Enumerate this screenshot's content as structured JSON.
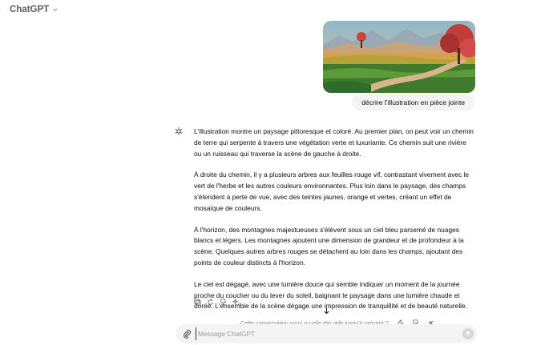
{
  "header": {
    "model_name": "ChatGPT"
  },
  "conversation": {
    "user_message": {
      "text": "décrire l'illustration en pièce jointe"
    },
    "assistant_message": {
      "paragraphs": [
        "L'illustration montre un paysage pittoresque et coloré. Au premier plan, on peut voir un chemin de terre qui serpente à travers une végétation verte et luxuriante. Ce chemin suit une rivière ou un ruisseau qui traverse la scène de gauche à droite.",
        "À droite du chemin, il y a plusieurs arbres aux feuilles rouge vif, contrastant vivement avec le vert de l'herbe et les autres couleurs environnantes. Plus loin dans le paysage, des champs s'étendent à perte de vue, avec des teintes jaunes, orange et vertes, créant un effet de mosaïque de couleurs.",
        "À l'horizon, des montagnes majestueuses s'élèvent sous un ciel bleu parsemé de nuages blancs et légers. Les montagnes ajoutent une dimension de grandeur et de profondeur à la scène. Quelques autres arbres rouges se détachent au loin dans les champs, ajoutant des points de couleur distincts à l'horizon.",
        "Le ciel est dégagé, avec une lumière douce qui semble indiquer un moment de la journée proche du coucher ou du lever du soleil, baignant le paysage dans une lumière chaude et dorée. L'ensemble de la scène dégage une impression de tranquillité et de beauté naturelle."
      ]
    }
  },
  "feedback": {
    "prompt": "Cette conversation vous a-t-elle été utile jusqu'à présent ?"
  },
  "composer": {
    "placeholder": "Message ChatGPT"
  },
  "icons": {
    "avatar": "openai-logo-icon",
    "actions": [
      "copy-icon",
      "regenerate-icon",
      "thumbs-down-icon",
      "sparkle-model-icon"
    ],
    "feedback": [
      "thumbs-up-icon",
      "thumbs-down-icon",
      "close-icon"
    ],
    "composer": [
      "paperclip-icon",
      "send-arrow-icon"
    ]
  },
  "colors": {
    "bubble": "#f4f4f4",
    "composer": "#f4f4f4",
    "send_disabled": "#d7d7d7"
  }
}
